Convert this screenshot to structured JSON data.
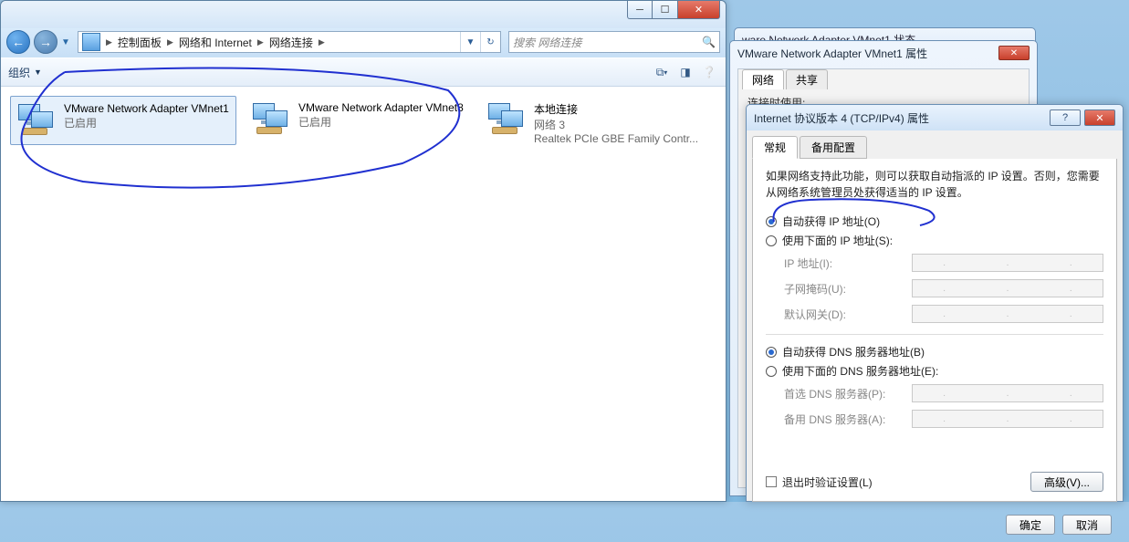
{
  "explorer": {
    "breadcrumbs": [
      "控制面板",
      "网络和 Internet",
      "网络连接"
    ],
    "search_placeholder": "搜索 网络连接",
    "toolbar": {
      "organize": "组织"
    },
    "connections": [
      {
        "name": "VMware Network Adapter VMnet1",
        "status": "已启用",
        "selected": true
      },
      {
        "name": "VMware Network Adapter VMnet8",
        "status": "已启用",
        "selected": false
      },
      {
        "name": "本地连接",
        "status": "网络 3",
        "detail": "Realtek PCIe GBE Family Contr...",
        "selected": false
      }
    ]
  },
  "adapter_status_window": {
    "title_partial": "ware Network Adapter VMnet1 状态"
  },
  "adapter_prop_window": {
    "title": "VMware Network Adapter VMnet1 属性",
    "tabs": [
      "网络",
      "共享"
    ],
    "hint": "连接时使用:"
  },
  "ipv4": {
    "title": "Internet 协议版本 4 (TCP/IPv4) 属性",
    "tabs": [
      "常规",
      "备用配置"
    ],
    "description": "如果网络支持此功能，则可以获取自动指派的 IP 设置。否则，您需要从网络系统管理员处获得适当的 IP 设置。",
    "ip_group": {
      "auto": "自动获得 IP 地址(O)",
      "manual": "使用下面的 IP 地址(S):",
      "fields": {
        "ip": "IP 地址(I):",
        "mask": "子网掩码(U):",
        "gateway": "默认网关(D):"
      },
      "selected": "auto"
    },
    "dns_group": {
      "auto": "自动获得 DNS 服务器地址(B)",
      "manual": "使用下面的 DNS 服务器地址(E):",
      "fields": {
        "primary": "首选 DNS 服务器(P):",
        "alternate": "备用 DNS 服务器(A):"
      },
      "selected": "auto"
    },
    "validate_checkbox": "退出时验证设置(L)",
    "advanced_button": "高级(V)...",
    "ok": "确定",
    "cancel": "取消"
  }
}
